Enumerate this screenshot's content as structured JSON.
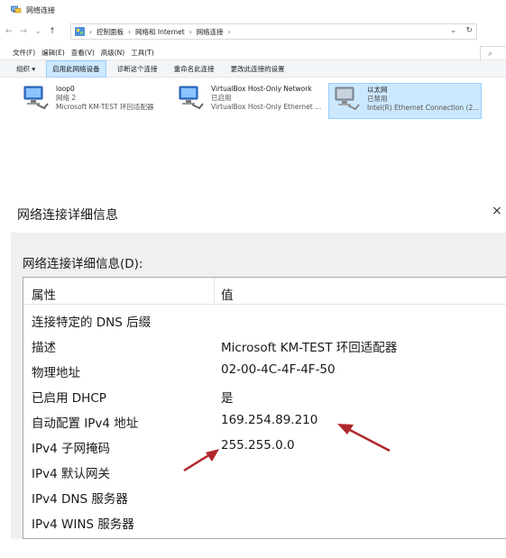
{
  "explorer": {
    "title": "网络连接",
    "address": {
      "crumbs": [
        "控制面板",
        "网络和 Internet",
        "网络连接"
      ],
      "back_glyph": "←",
      "forward_glyph": "→",
      "recent_glyph": "⌄",
      "up_glyph": "↑",
      "dropdown_glyph": "⌄",
      "refresh_glyph": "↻",
      "search_glyph": "⌕"
    },
    "menu": [
      "文件(F)",
      "编辑(E)",
      "查看(V)",
      "高级(N)",
      "工具(T)"
    ],
    "commands": [
      {
        "label": "组织 ▾",
        "active": false
      },
      {
        "label": "启用此网络设备",
        "active": true
      },
      {
        "label": "诊断这个连接",
        "active": false
      },
      {
        "label": "重命名此连接",
        "active": false
      },
      {
        "label": "更改此连接的设置",
        "active": false
      }
    ],
    "adapters": [
      {
        "name": "loop0",
        "status": "网络 2",
        "device": "Microsoft KM-TEST 环回适配器",
        "selected": false,
        "icon": "network-adapter-icon"
      },
      {
        "name": "VirtualBox Host-Only Network",
        "status": "已启用",
        "device": "VirtualBox Host-Only Ethernet ...",
        "selected": false,
        "icon": "network-adapter-icon"
      },
      {
        "name": "以太网",
        "status": "已禁用",
        "device": "Intel(R) Ethernet Connection (2...",
        "selected": true,
        "icon": "network-adapter-disabled-icon"
      }
    ]
  },
  "dialog": {
    "title": "网络连接详细信息",
    "close_glyph": "×",
    "label": "网络连接详细信息(D):",
    "columns": {
      "property": "属性",
      "value": "值"
    },
    "rows": [
      {
        "property": "连接特定的 DNS 后缀",
        "value": ""
      },
      {
        "property": "描述",
        "value": "Microsoft KM-TEST 环回适配器"
      },
      {
        "property": "物理地址",
        "value": "02-00-4C-4F-4F-50"
      },
      {
        "property": "已启用 DHCP",
        "value": "是"
      },
      {
        "property": "自动配置 IPv4 地址",
        "value": "169.254.89.210"
      },
      {
        "property": "IPv4 子网掩码",
        "value": "255.255.0.0"
      },
      {
        "property": "IPv4 默认网关",
        "value": ""
      },
      {
        "property": "IPv4 DNS 服务器",
        "value": ""
      },
      {
        "property": "IPv4 WINS 服务器",
        "value": ""
      }
    ]
  },
  "colors": {
    "annotation_arrow": "#b0262b",
    "selection_fill": "#cce8ff",
    "selection_border": "#99d1ff"
  }
}
